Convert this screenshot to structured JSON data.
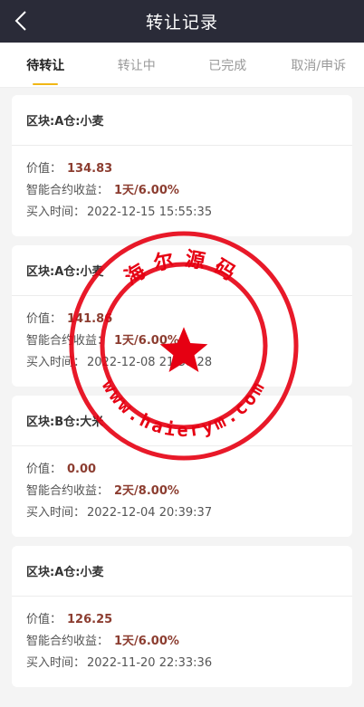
{
  "header": {
    "title": "转让记录",
    "back_icon": "chevron-left-icon"
  },
  "tabs": [
    {
      "label": "待转让",
      "active": true
    },
    {
      "label": "转让中",
      "active": false
    },
    {
      "label": "已完成",
      "active": false
    },
    {
      "label": "取消/申诉",
      "active": false
    }
  ],
  "records": [
    {
      "block": "区块:A仓:小麦",
      "value_label": "价值：",
      "value": "134.83",
      "yield_label": "智能合约收益：",
      "yield": "1天/6.00%",
      "time_label": "买入时间：",
      "time": "2022-12-15 15:55:35"
    },
    {
      "block": "区块:A仓:小麦",
      "value_label": "价值：",
      "value": "141.86",
      "yield_label": "智能合约收益：",
      "yield": "1天/6.00%",
      "time_label": "买入时间：",
      "time": "2022-12-08 21:38:28"
    },
    {
      "block": "区块:B仓:大米",
      "value_label": "价值：",
      "value": "0.00",
      "yield_label": "智能合约收益：",
      "yield": "2天/8.00%",
      "time_label": "买入时间：",
      "time": "2022-12-04 20:39:37"
    },
    {
      "block": "区块:A仓:小麦",
      "value_label": "价值：",
      "value": "126.25",
      "yield_label": "智能合约收益：",
      "yield": "1天/6.00%",
      "time_label": "买入时间：",
      "time": "2022-11-20 22:33:36"
    }
  ],
  "watermark": {
    "top_text": "海尔源码",
    "bottom_text": "www.haierym.com",
    "color": "#e60012"
  },
  "colors": {
    "header_bg": "#2a2b38",
    "accent": "#f1b715",
    "value": "#8c3d30"
  }
}
